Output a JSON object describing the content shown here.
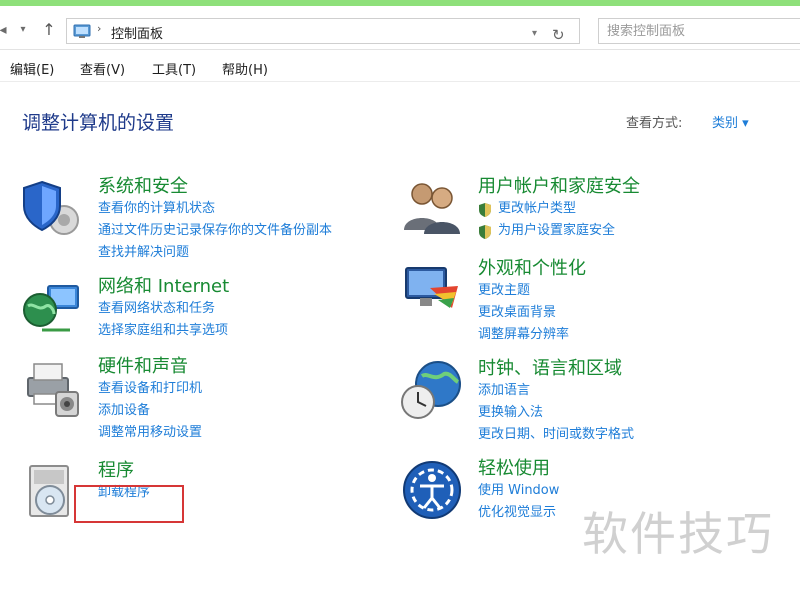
{
  "address": {
    "path": "控制面板",
    "search_placeholder": "搜索控制面板"
  },
  "menubar": {
    "items": [
      "编辑(E)",
      "查看(V)",
      "工具(T)",
      "帮助(H)"
    ]
  },
  "header": {
    "title": "调整计算机的设置",
    "view_by_label": "查看方式:",
    "view_by_value": "类别 ▾"
  },
  "categories": [
    {
      "title": "系统和安全",
      "links": [
        "查看你的计算机状态",
        "通过文件历史记录保存你的文件备份副本",
        "查找并解决问题"
      ]
    },
    {
      "title": "网络和 Internet",
      "links": [
        "查看网络状态和任务",
        "选择家庭组和共享选项"
      ]
    },
    {
      "title": "硬件和声音",
      "links": [
        "查看设备和打印机",
        "添加设备",
        "调整常用移动设置"
      ]
    },
    {
      "title": "程序",
      "links": [
        "卸载程序"
      ]
    },
    {
      "title": "用户帐户和家庭安全",
      "links": [
        "更改帐户类型",
        "为用户设置家庭安全"
      ]
    },
    {
      "title": "外观和个性化",
      "links": [
        "更改主题",
        "更改桌面背景",
        "调整屏幕分辨率"
      ]
    },
    {
      "title": "时钟、语言和区域",
      "links": [
        "添加语言",
        "更换输入法",
        "更改日期、时间或数字格式"
      ]
    },
    {
      "title": "轻松使用",
      "links": [
        "使用 Window",
        "优化视觉显示"
      ]
    }
  ],
  "watermark": "软件技巧",
  "colors": {
    "category_title": "#178a32",
    "link": "#1e7dd8",
    "page_title": "#1e3a8a",
    "highlight": "#d63636",
    "top_accent": "#8ee07a"
  }
}
